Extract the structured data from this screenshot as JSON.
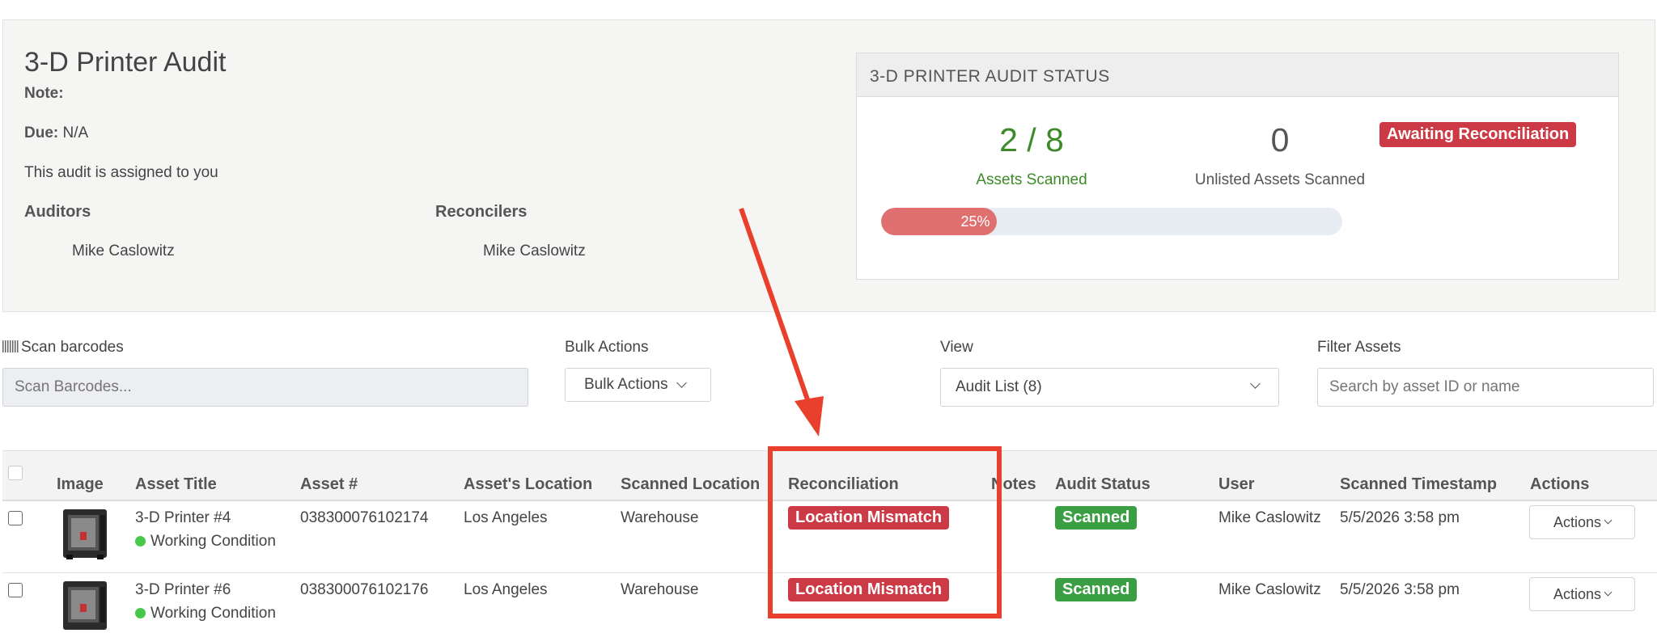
{
  "audit": {
    "title": "3-D Printer Audit",
    "note_label": "Note:",
    "note_value": "",
    "due_label": "Due:",
    "due_value": "N/A",
    "assigned_text": "This audit is assigned to you",
    "auditors_label": "Auditors",
    "auditors": [
      "Mike Caslowitz"
    ],
    "reconcilers_label": "Reconcilers",
    "reconcilers": [
      "Mike Caslowitz"
    ]
  },
  "status": {
    "header": "3-D PRINTER AUDIT STATUS",
    "scanned_value": "2 / 8",
    "scanned_label": "Assets Scanned",
    "unlisted_value": "0",
    "unlisted_label": "Unlisted Assets Scanned",
    "progress_text": "25%",
    "progress_fraction": 0.25,
    "state_badge": "Awaiting Reconciliation"
  },
  "controls": {
    "scan_label": "Scan barcodes",
    "scan_placeholder": "Scan Barcodes...",
    "bulk_label": "Bulk Actions",
    "bulk_button": "Bulk Actions",
    "view_label": "View",
    "view_value": "Audit List (8)",
    "filter_label": "Filter Assets",
    "filter_placeholder": "Search by asset ID or name"
  },
  "table": {
    "columns": [
      "Image",
      "Asset Title",
      "Asset #",
      "Asset's Location",
      "Scanned Location",
      "Reconciliation",
      "Notes",
      "Audit Status",
      "User",
      "Scanned Timestamp",
      "Actions"
    ],
    "rows": [
      {
        "title": "3-D Printer #4",
        "condition": "Working Condition",
        "asset_no": "038300076102174",
        "location": "Los Angeles",
        "scanned_location": "Warehouse",
        "reconciliation": "Location Mismatch",
        "notes": "",
        "audit_status": "Scanned",
        "user": "Mike Caslowitz",
        "timestamp": "5/5/2026 3:58 pm",
        "actions": "Actions"
      },
      {
        "title": "3-D Printer #6",
        "condition": "Working Condition",
        "asset_no": "038300076102176",
        "location": "Los Angeles",
        "scanned_location": "Warehouse",
        "reconciliation": "Location Mismatch",
        "notes": "",
        "audit_status": "Scanned",
        "user": "Mike Caslowitz",
        "timestamp": "5/5/2026 3:58 pm",
        "actions": "Actions"
      }
    ]
  },
  "colors": {
    "annotation": "#e8402c",
    "badge_red": "#cc3a45",
    "badge_green": "#3a9e43",
    "scanned_green": "#3c8a28"
  }
}
